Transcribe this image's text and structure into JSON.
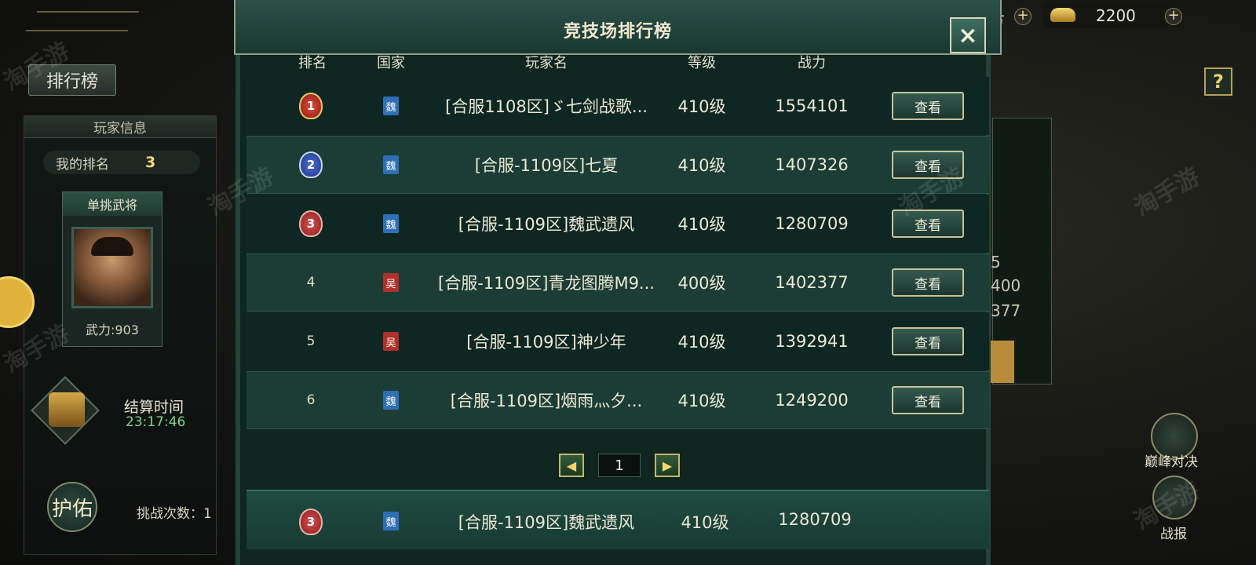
{
  "header": {
    "currency_left_fragment": "方",
    "gold_amount": "2200",
    "plus": "+"
  },
  "left": {
    "tab_label": "排行榜",
    "panel_title": "玩家信息",
    "my_rank_label": "我的排名",
    "my_rank_value": "3",
    "general_title": "单挑武将",
    "general_power": "武力:903",
    "settle_label": "结算时间",
    "settle_time": "23:17:46",
    "guard_label": "护佑",
    "challenge_label": "挑战次数：1"
  },
  "right": {
    "help": "?",
    "frag1": "5",
    "frag2": "400",
    "frag3": "377",
    "peak_label": "巅峰对决",
    "report_label": "战报"
  },
  "modal": {
    "title": "竞技场排行榜",
    "close_icon": "×",
    "columns": [
      "排名",
      "国家",
      "玩家名",
      "等级",
      "战力"
    ],
    "view_label": "查看",
    "rows": [
      {
        "rank": "1",
        "nation": "魏",
        "name": "[合服1108区]ゞ七剑战歌...",
        "level": "410级",
        "power": "1554101"
      },
      {
        "rank": "2",
        "nation": "魏",
        "name": "[合服-1109区]七夏",
        "level": "410级",
        "power": "1407326"
      },
      {
        "rank": "3",
        "nation": "魏",
        "name": "[合服-1109区]魏武遗风",
        "level": "410级",
        "power": "1280709"
      },
      {
        "rank": "4",
        "nation": "吴",
        "name": "[合服-1109区]青龙图腾M9...",
        "level": "400级",
        "power": "1402377"
      },
      {
        "rank": "5",
        "nation": "吴",
        "name": "[合服-1109区]神少年",
        "level": "410级",
        "power": "1392941"
      },
      {
        "rank": "6",
        "nation": "魏",
        "name": "[合服-1109区]烟雨灬夕...",
        "level": "410级",
        "power": "1249200"
      }
    ],
    "pager": {
      "prev": "◀",
      "page": "1",
      "next": "▶"
    },
    "my_row": {
      "rank": "3",
      "nation": "魏",
      "name": "[合服-1109区]魏武遗风",
      "level": "410级",
      "power": "1280709"
    }
  },
  "watermark": "淘手游",
  "colors": {
    "wei": "#2f6fb5",
    "wu": "#b0302a",
    "accent": "#f3dc75"
  }
}
